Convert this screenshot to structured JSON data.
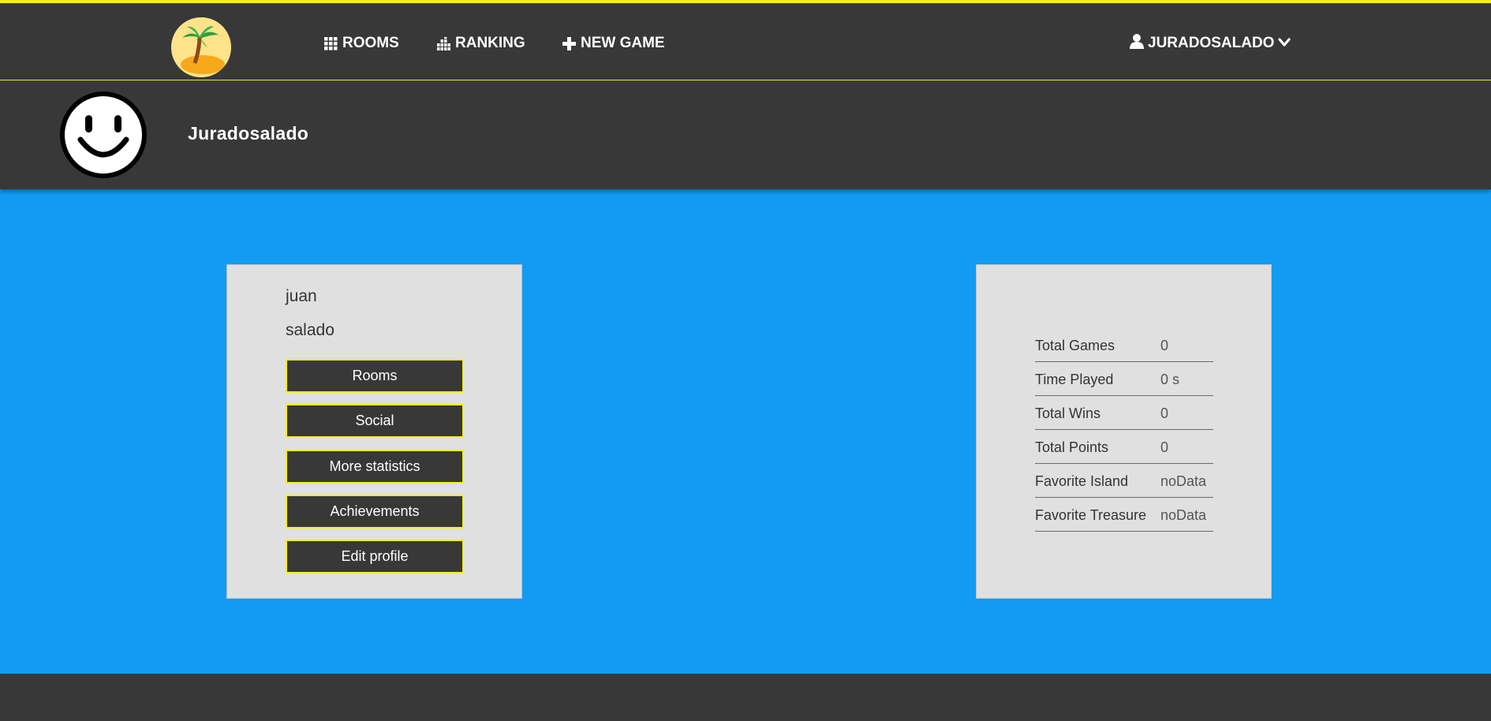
{
  "colors": {
    "dark": "#383838",
    "accent_yellow": "#f5ef1a",
    "main_blue": "#139bf2",
    "card_bg": "#e0e0e0"
  },
  "navbar": {
    "logo_icon": "palm-island-icon",
    "items": [
      {
        "label": "ROOMS",
        "icon": "grid-icon"
      },
      {
        "label": "RANKING",
        "icon": "bar-chart-icon"
      },
      {
        "label": "NEW GAME",
        "icon": "plus-icon"
      }
    ],
    "user": {
      "label": "JURADOSALADO",
      "icon": "user-icon",
      "caret": "chevron-down-icon"
    }
  },
  "profile": {
    "avatar_icon": "smiley-face-icon",
    "display_name": "Juradosalado"
  },
  "user_card": {
    "first_name": "juan",
    "last_name": "salado",
    "buttons": [
      "Rooms",
      "Social",
      "More statistics",
      "Achievements",
      "Edit profile"
    ]
  },
  "stats_card": {
    "rows": [
      {
        "label": "Total Games",
        "value": "0"
      },
      {
        "label": "Time Played",
        "value": "0 s"
      },
      {
        "label": "Total Wins",
        "value": "0"
      },
      {
        "label": "Total Points",
        "value": "0"
      },
      {
        "label": "Favorite Island",
        "value": "noData"
      },
      {
        "label": "Favorite Treasure",
        "value": "noData"
      }
    ]
  }
}
